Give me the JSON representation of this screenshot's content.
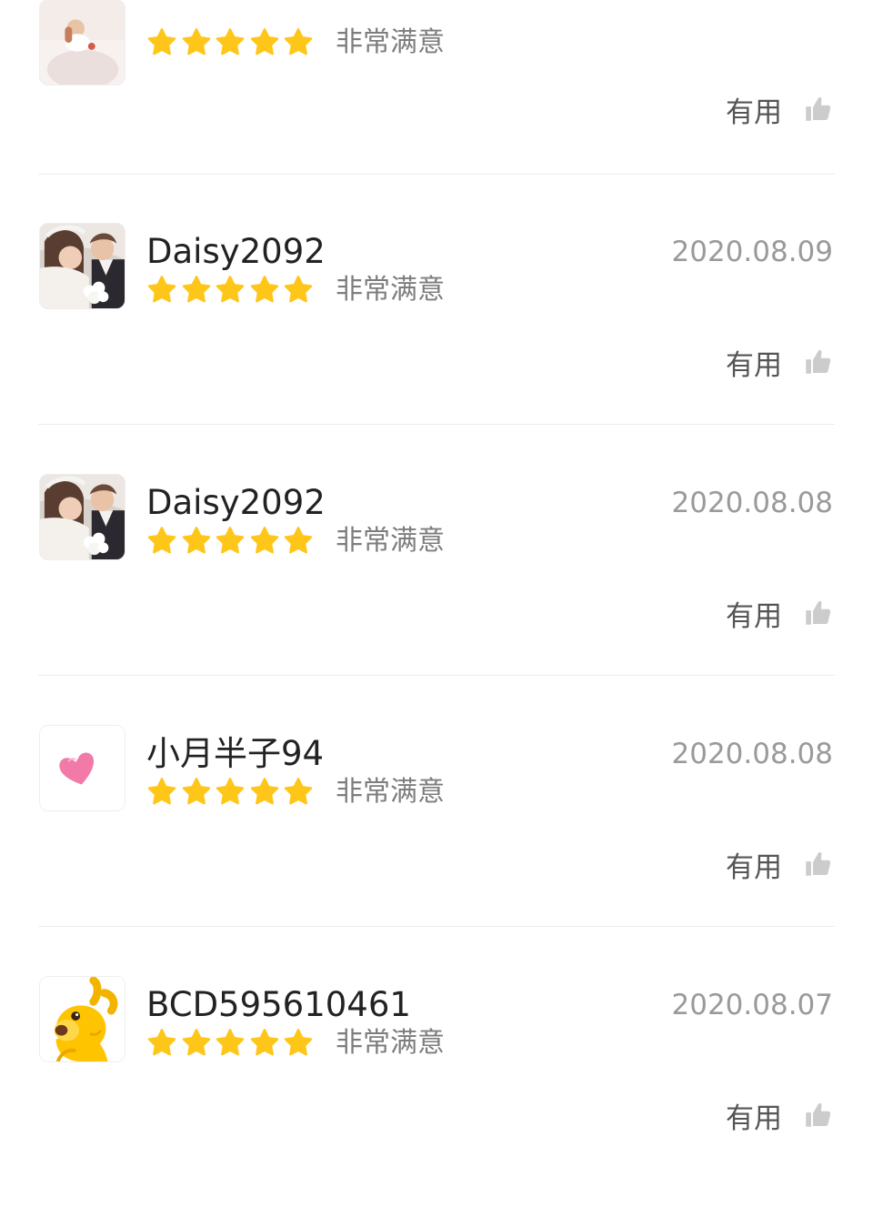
{
  "reviews": [
    {
      "username": "",
      "date": "",
      "rating": 5,
      "rating_text": "非常满意",
      "helpful_label": "有用",
      "avatar": "baby-photo"
    },
    {
      "username": "Daisy2092",
      "date": "2020.08.09",
      "rating": 5,
      "rating_text": "非常满意",
      "helpful_label": "有用",
      "avatar": "wedding-photo"
    },
    {
      "username": "Daisy2092",
      "date": "2020.08.08",
      "rating": 5,
      "rating_text": "非常满意",
      "helpful_label": "有用",
      "avatar": "wedding-photo"
    },
    {
      "username": "小月半子94",
      "date": "2020.08.08",
      "rating": 5,
      "rating_text": "非常满意",
      "helpful_label": "有用",
      "avatar": "pink-heart"
    },
    {
      "username": "BCD595610461",
      "date": "2020.08.07",
      "rating": 5,
      "rating_text": "非常满意",
      "helpful_label": "有用",
      "avatar": "yellow-kangaroo"
    }
  ],
  "colors": {
    "star": "#FFC61A",
    "thumb": "#CCCCCC",
    "divider": "#ECECEC"
  }
}
